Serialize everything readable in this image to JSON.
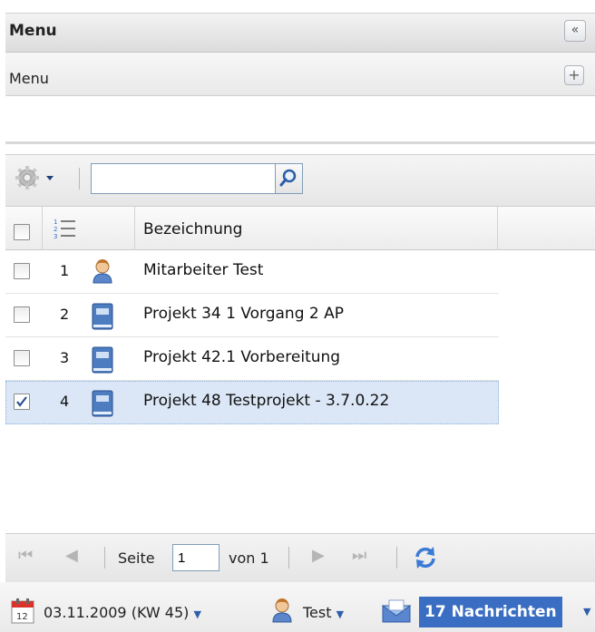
{
  "panel": {
    "title": "Menu",
    "collapse_icon": "«",
    "menu_label": "Menu",
    "add_icon": "+"
  },
  "toolbar": {
    "search_value": "",
    "search_placeholder": ""
  },
  "grid": {
    "columns": [
      "",
      "",
      "",
      "Bezeichnung"
    ],
    "rows": [
      {
        "num": "1",
        "icon": "user-icon",
        "label": "Mitarbeiter Test",
        "checked": false
      },
      {
        "num": "2",
        "icon": "project-book-icon",
        "label": "Projekt 34 1 Vorgang 2 AP",
        "checked": false
      },
      {
        "num": "3",
        "icon": "project-book-icon",
        "label": "Projekt 42.1 Vorbereitung",
        "checked": false
      },
      {
        "num": "4",
        "icon": "project-book-icon",
        "label": "Projekt 48 Testprojekt - 3.7.0.22",
        "checked": true
      }
    ]
  },
  "pager": {
    "page_label": "Seite",
    "page_value": "1",
    "of_label": "von 1"
  },
  "status": {
    "date": "03.11.2009 (KW 45)",
    "user": "Test",
    "messages": "17 Nachrichten"
  },
  "colors": {
    "accent": "#3a6ec2",
    "selection": "#dbe7f6"
  }
}
